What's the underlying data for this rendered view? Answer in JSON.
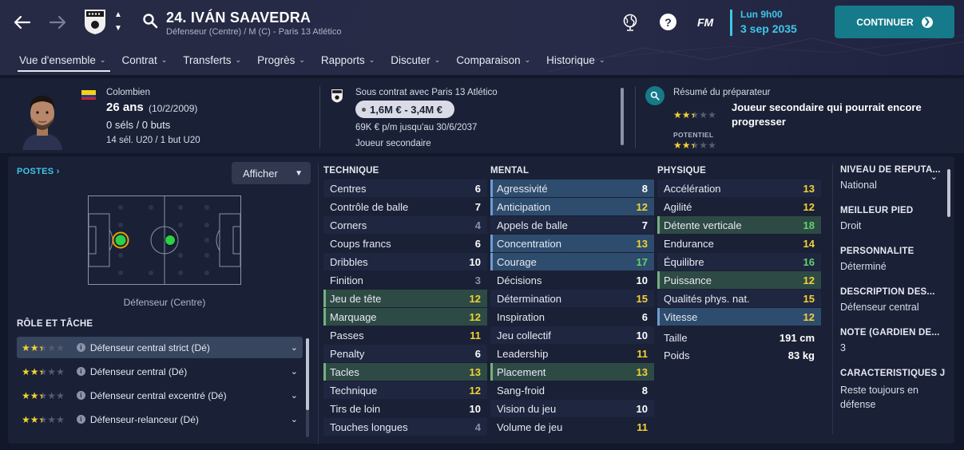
{
  "header": {
    "player_title": "24. IVÁN SAAVEDRA",
    "subtitle": "Défenseur (Centre) / M (C) - Paris 13 Atlético",
    "fm_label": "FM",
    "date_time": "Lun 9h00",
    "date_day": "3 sep 2035",
    "continue_label": "CONTINUER"
  },
  "tabs": [
    {
      "label": "Vue d'ensemble"
    },
    {
      "label": "Contrat"
    },
    {
      "label": "Transferts"
    },
    {
      "label": "Progrès"
    },
    {
      "label": "Rapports"
    },
    {
      "label": "Discuter"
    },
    {
      "label": "Comparaison"
    },
    {
      "label": "Historique"
    }
  ],
  "info": {
    "nationality": "Colombien",
    "age": "26 ans",
    "birthdate": "(10/2/2009)",
    "caps": "0 séls / 0 buts",
    "u20": "14 sél. U20 / 1 but U20",
    "contract_with": "Sous contrat avec Paris 13 Atlético",
    "value_range": "1,6M € - 3,4M €",
    "wage": "69K € p/m jusqu'au 30/6/2037",
    "squad_status": "Joueur secondaire",
    "scout_label": "Résumé du préparateur",
    "scout_summary": "Joueur secondaire qui pourrait encore progresser",
    "potential_label": "POTENTIEL",
    "current_ability_stars": 2.5,
    "potential_stars": 2.5
  },
  "left": {
    "postes_label": "POSTES",
    "show_label": "Afficher",
    "position_label": "Défenseur (Centre)",
    "role_heading": "RÔLE ET TÂCHE",
    "roles": [
      {
        "name": "Défenseur central strict (Dé)",
        "stars": 2.5
      },
      {
        "name": "Défenseur central (Dé)",
        "stars": 2.5
      },
      {
        "name": "Défenseur central excentré (Dé)",
        "stars": 2.5
      },
      {
        "name": "Défenseur-relanceur (Dé)",
        "stars": 2.5
      }
    ]
  },
  "technique": {
    "heading": "TECHNIQUE",
    "attrs": [
      {
        "name": "Centres",
        "value": "6"
      },
      {
        "name": "Contrôle de balle",
        "value": "7"
      },
      {
        "name": "Corners",
        "value": "4"
      },
      {
        "name": "Coups francs",
        "value": "6"
      },
      {
        "name": "Dribbles",
        "value": "10"
      },
      {
        "name": "Finition",
        "value": "3"
      },
      {
        "name": "Jeu de tête",
        "value": "12"
      },
      {
        "name": "Marquage",
        "value": "12"
      },
      {
        "name": "Passes",
        "value": "11"
      },
      {
        "name": "Penalty",
        "value": "6"
      },
      {
        "name": "Tacles",
        "value": "13"
      },
      {
        "name": "Technique",
        "value": "12"
      },
      {
        "name": "Tirs de loin",
        "value": "10"
      },
      {
        "name": "Touches longues",
        "value": "4"
      }
    ]
  },
  "mental": {
    "heading": "MENTAL",
    "attrs": [
      {
        "name": "Agressivité",
        "value": "8"
      },
      {
        "name": "Anticipation",
        "value": "12"
      },
      {
        "name": "Appels de balle",
        "value": "7"
      },
      {
        "name": "Concentration",
        "value": "13"
      },
      {
        "name": "Courage",
        "value": "17"
      },
      {
        "name": "Décisions",
        "value": "10"
      },
      {
        "name": "Détermination",
        "value": "15"
      },
      {
        "name": "Inspiration",
        "value": "6"
      },
      {
        "name": "Jeu collectif",
        "value": "10"
      },
      {
        "name": "Leadership",
        "value": "11"
      },
      {
        "name": "Placement",
        "value": "13"
      },
      {
        "name": "Sang-froid",
        "value": "8"
      },
      {
        "name": "Vision du jeu",
        "value": "10"
      },
      {
        "name": "Volume de jeu",
        "value": "11"
      }
    ]
  },
  "physique": {
    "heading": "PHYSIQUE",
    "attrs": [
      {
        "name": "Accélération",
        "value": "13"
      },
      {
        "name": "Agilité",
        "value": "12"
      },
      {
        "name": "Détente verticale",
        "value": "18"
      },
      {
        "name": "Endurance",
        "value": "14"
      },
      {
        "name": "Équilibre",
        "value": "16"
      },
      {
        "name": "Puissance",
        "value": "12"
      },
      {
        "name": "Qualités phys. nat.",
        "value": "15"
      },
      {
        "name": "Vitesse",
        "value": "12"
      }
    ],
    "height_label": "Taille",
    "height_value": "191 cm",
    "weight_label": "Poids",
    "weight_value": "83 kg"
  },
  "rightcol": [
    {
      "title": "NIVEAU DE RÉPUTA...",
      "value": "National"
    },
    {
      "title": "MEILLEUR PIED",
      "value": "Droit"
    },
    {
      "title": "PERSONNALITÉ",
      "value": "Déterminé"
    },
    {
      "title": "DESCRIPTION DES...",
      "value": "Défenseur central"
    },
    {
      "title": "NOTE (GARDIEN DE...",
      "value": "3"
    },
    {
      "title": "CARACTÉRISTIQUES JO",
      "value": "Reste toujours en défense"
    }
  ],
  "colors": {
    "accent": "#3ec7e6",
    "continue_bg": "#157a8a",
    "attr_grey": "#8a8fa3",
    "attr_white": "#ffffff",
    "attr_yellow": "#f2d233",
    "attr_green": "#63d36a"
  }
}
